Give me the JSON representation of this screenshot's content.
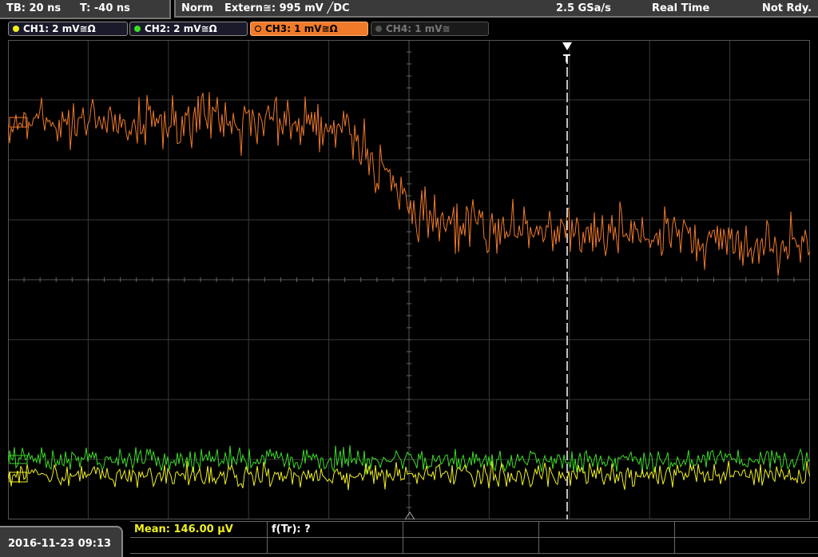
{
  "timebase": {
    "tb": "TB: 20 ns",
    "trigger_time": "T: -40 ns"
  },
  "status": {
    "mode": "Norm",
    "trigger_source": "Extern≅: 995 mV ╱DC",
    "sample_rate": "2.5 GSa/s",
    "acq_mode": "Real Time",
    "trigger_state": "Not Rdy."
  },
  "channels": [
    {
      "label": "CH1: 2 mV≅Ω",
      "color": "#f0f020",
      "state": "on"
    },
    {
      "label": "CH2: 2 mV≅Ω",
      "color": "#3cdc28",
      "state": "on"
    },
    {
      "label": "CH3: 1 mV≅Ω",
      "color": "#f07a2a",
      "state": "active"
    },
    {
      "label": "CH4: 1 mV≅",
      "color": "#777777",
      "state": "off"
    }
  ],
  "colors": {
    "ch1": "#f0f020",
    "ch2": "#3cdc28",
    "ch3": "#f07a2a",
    "grid": "#3a3a3a",
    "trigger_line": "#ffffff"
  },
  "bottom": {
    "datetime": "2016-11-23 09:13",
    "measurements": [
      {
        "label": "Mean: 146.00 µV",
        "color": "#f0f020"
      },
      {
        "label": "f(Tr): ?",
        "color": "#ffffff"
      }
    ]
  },
  "trigger_marker": "T"
}
